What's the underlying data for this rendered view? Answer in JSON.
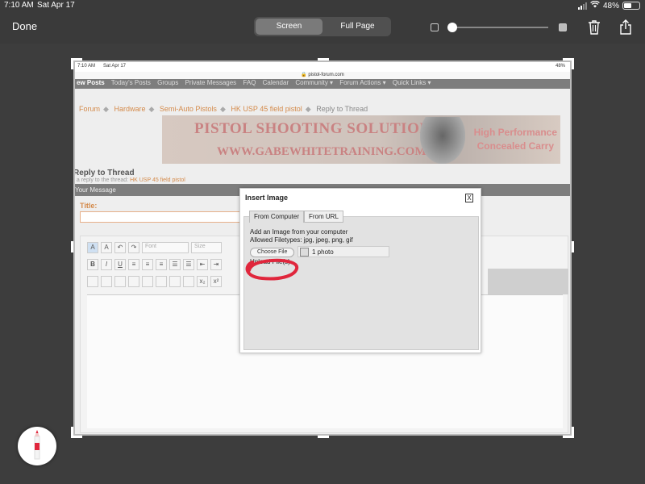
{
  "status_bar": {
    "time": "7:10 AM",
    "date": "Sat Apr 17",
    "battery": "48%"
  },
  "markup_bar": {
    "done": "Done",
    "tabs": [
      "Screen",
      "Full Page"
    ],
    "active_tab": "Screen"
  },
  "inner": {
    "status": {
      "time": "7:10 AM",
      "date": "Sat Apr 17",
      "battery": "48%"
    },
    "url": "pistol-forum.com",
    "nav_items": [
      "ew Posts",
      "Today's Posts",
      "Groups",
      "Private Messages",
      "FAQ",
      "Calendar",
      "Community ▾",
      "Forum Actions ▾",
      "Quick Links ▾"
    ],
    "breadcrumbs": [
      "Forum",
      "Hardware",
      "Semi-Auto Pistols",
      "HK USP 45 field pistol",
      "Reply to Thread"
    ],
    "banner": {
      "title": "PISTOL SHOOTING SOLUTIONS",
      "site": "WWW.GABEWHITETRAINING.COM",
      "tag1": "High Performance",
      "tag2": "Concealed Carry"
    },
    "reply_title": "Reply to Thread",
    "reply_sub_prefix": "t a reply to the thread:",
    "reply_sub_link": "HK USP 45 field pistol",
    "message_bar": "Your Message",
    "title_label": "Title:",
    "font_placeholder": "Font",
    "size_placeholder": "Size"
  },
  "modal": {
    "title": "Insert Image",
    "close": "X",
    "tabs": [
      "From Computer",
      "From URL"
    ],
    "heading": "Add an Image from your computer",
    "filetypes": "Allowed Filetypes: jpg, jpeg, png, gif",
    "choose_file": "Choose File",
    "file_count": "1 photo",
    "upload": "Upload File(s)"
  },
  "colors": {
    "accent_orange": "#d48a4a",
    "annotation_red": "#e0263c"
  },
  "icons": [
    "signal-icon",
    "wifi-icon",
    "battery-icon",
    "trash-icon",
    "share-icon",
    "lock-icon",
    "pencil-icon"
  ]
}
